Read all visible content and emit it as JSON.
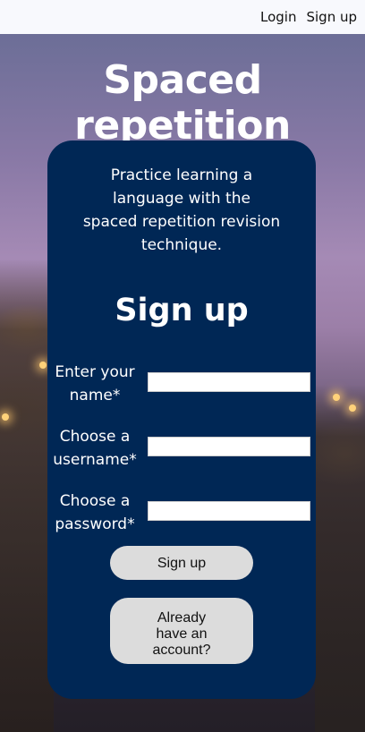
{
  "nav": {
    "login": "Login",
    "signup": "Sign up"
  },
  "hero": {
    "title": "Spaced repetition"
  },
  "card": {
    "tagline": [
      "Practice learning a",
      "language with the",
      "spaced repetition revision",
      "technique."
    ],
    "form_title": "Sign up",
    "fields": [
      {
        "label": [
          "Enter your",
          "name*"
        ],
        "value": ""
      },
      {
        "label": [
          "Choose a",
          "username*"
        ],
        "value": ""
      },
      {
        "label": [
          "Choose a",
          "password*"
        ],
        "value": ""
      }
    ],
    "signup_button": "Sign up",
    "account_button": [
      "Already",
      "have an",
      "account?"
    ]
  }
}
